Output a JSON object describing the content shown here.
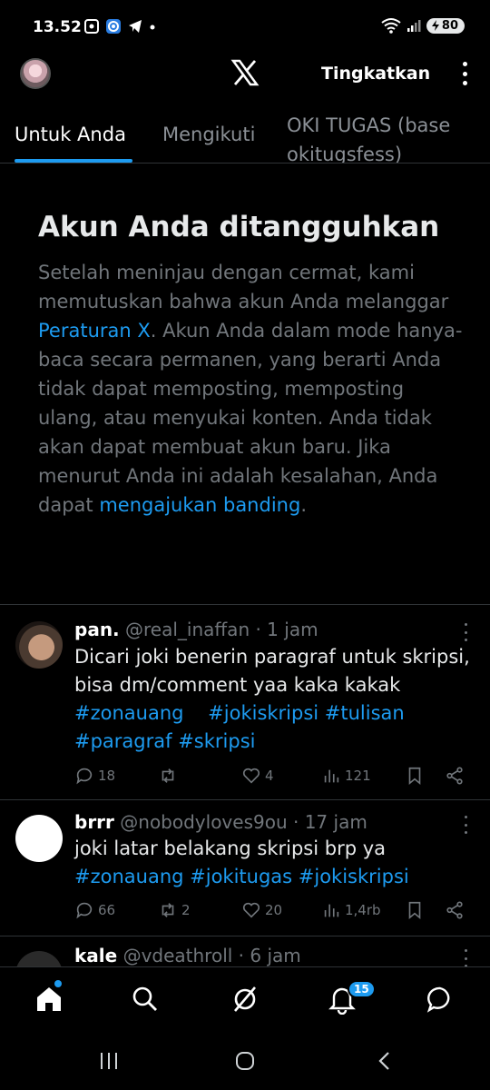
{
  "status_bar": {
    "time": "13.52",
    "battery": "80"
  },
  "header": {
    "upgrade_label": "Tingkatkan"
  },
  "tabs": [
    {
      "label": "Untuk Anda",
      "active": true
    },
    {
      "label": "Mengikuti",
      "active": false
    }
  ],
  "list_tab": {
    "line1": "OKI TUGAS (base",
    "line2": "okitugsfess)"
  },
  "notice": {
    "title": "Akun Anda ditangguhkan",
    "body_1": "Setelah meninjau dengan cermat, kami memutuskan bahwa akun Anda melanggar ",
    "rules_link": "Peraturan X",
    "body_2": ". Akun Anda dalam mode hanya-baca secara permanen, yang berarti Anda tidak dapat memposting, memposting ulang, atau menyukai konten. Anda tidak akan dapat membuat akun baru. Jika menurut Anda ini adalah kesalahan, Anda dapat ",
    "appeal_link": "mengajukan banding",
    "body_3": "."
  },
  "tweets": [
    {
      "name": "pan.",
      "handle_time": " @real_inaffan · 1 jam",
      "text_1": "Dicari joki benerin paragraf untuk skripsi, bisa dm/comment yaa kaka kakak",
      "hashtags_line1": "#zonauang    #jokiskripsi #tulisan",
      "hashtags_line2": "#paragraf #skripsi",
      "replies": "18",
      "reposts": "",
      "likes": "4",
      "views": "121"
    },
    {
      "name": "brrr",
      "handle_time": " @nobodyloves9ou · 17 jam",
      "text_1": "joki latar belakang skripsi brp ya",
      "hashtags_line1": "#zonauang #jokitugas #jokiskripsi",
      "replies": "66",
      "reposts": "2",
      "likes": "20",
      "views": "1,4rb"
    },
    {
      "name": "kale",
      "handle_time": " @vdeathroll · 6 jam"
    }
  ],
  "bottom_nav": {
    "notifications_badge": "15"
  },
  "colors": {
    "background": "#000000",
    "accent": "#1d9bf0",
    "muted_text": "#71767b",
    "divider": "#2f3336"
  }
}
